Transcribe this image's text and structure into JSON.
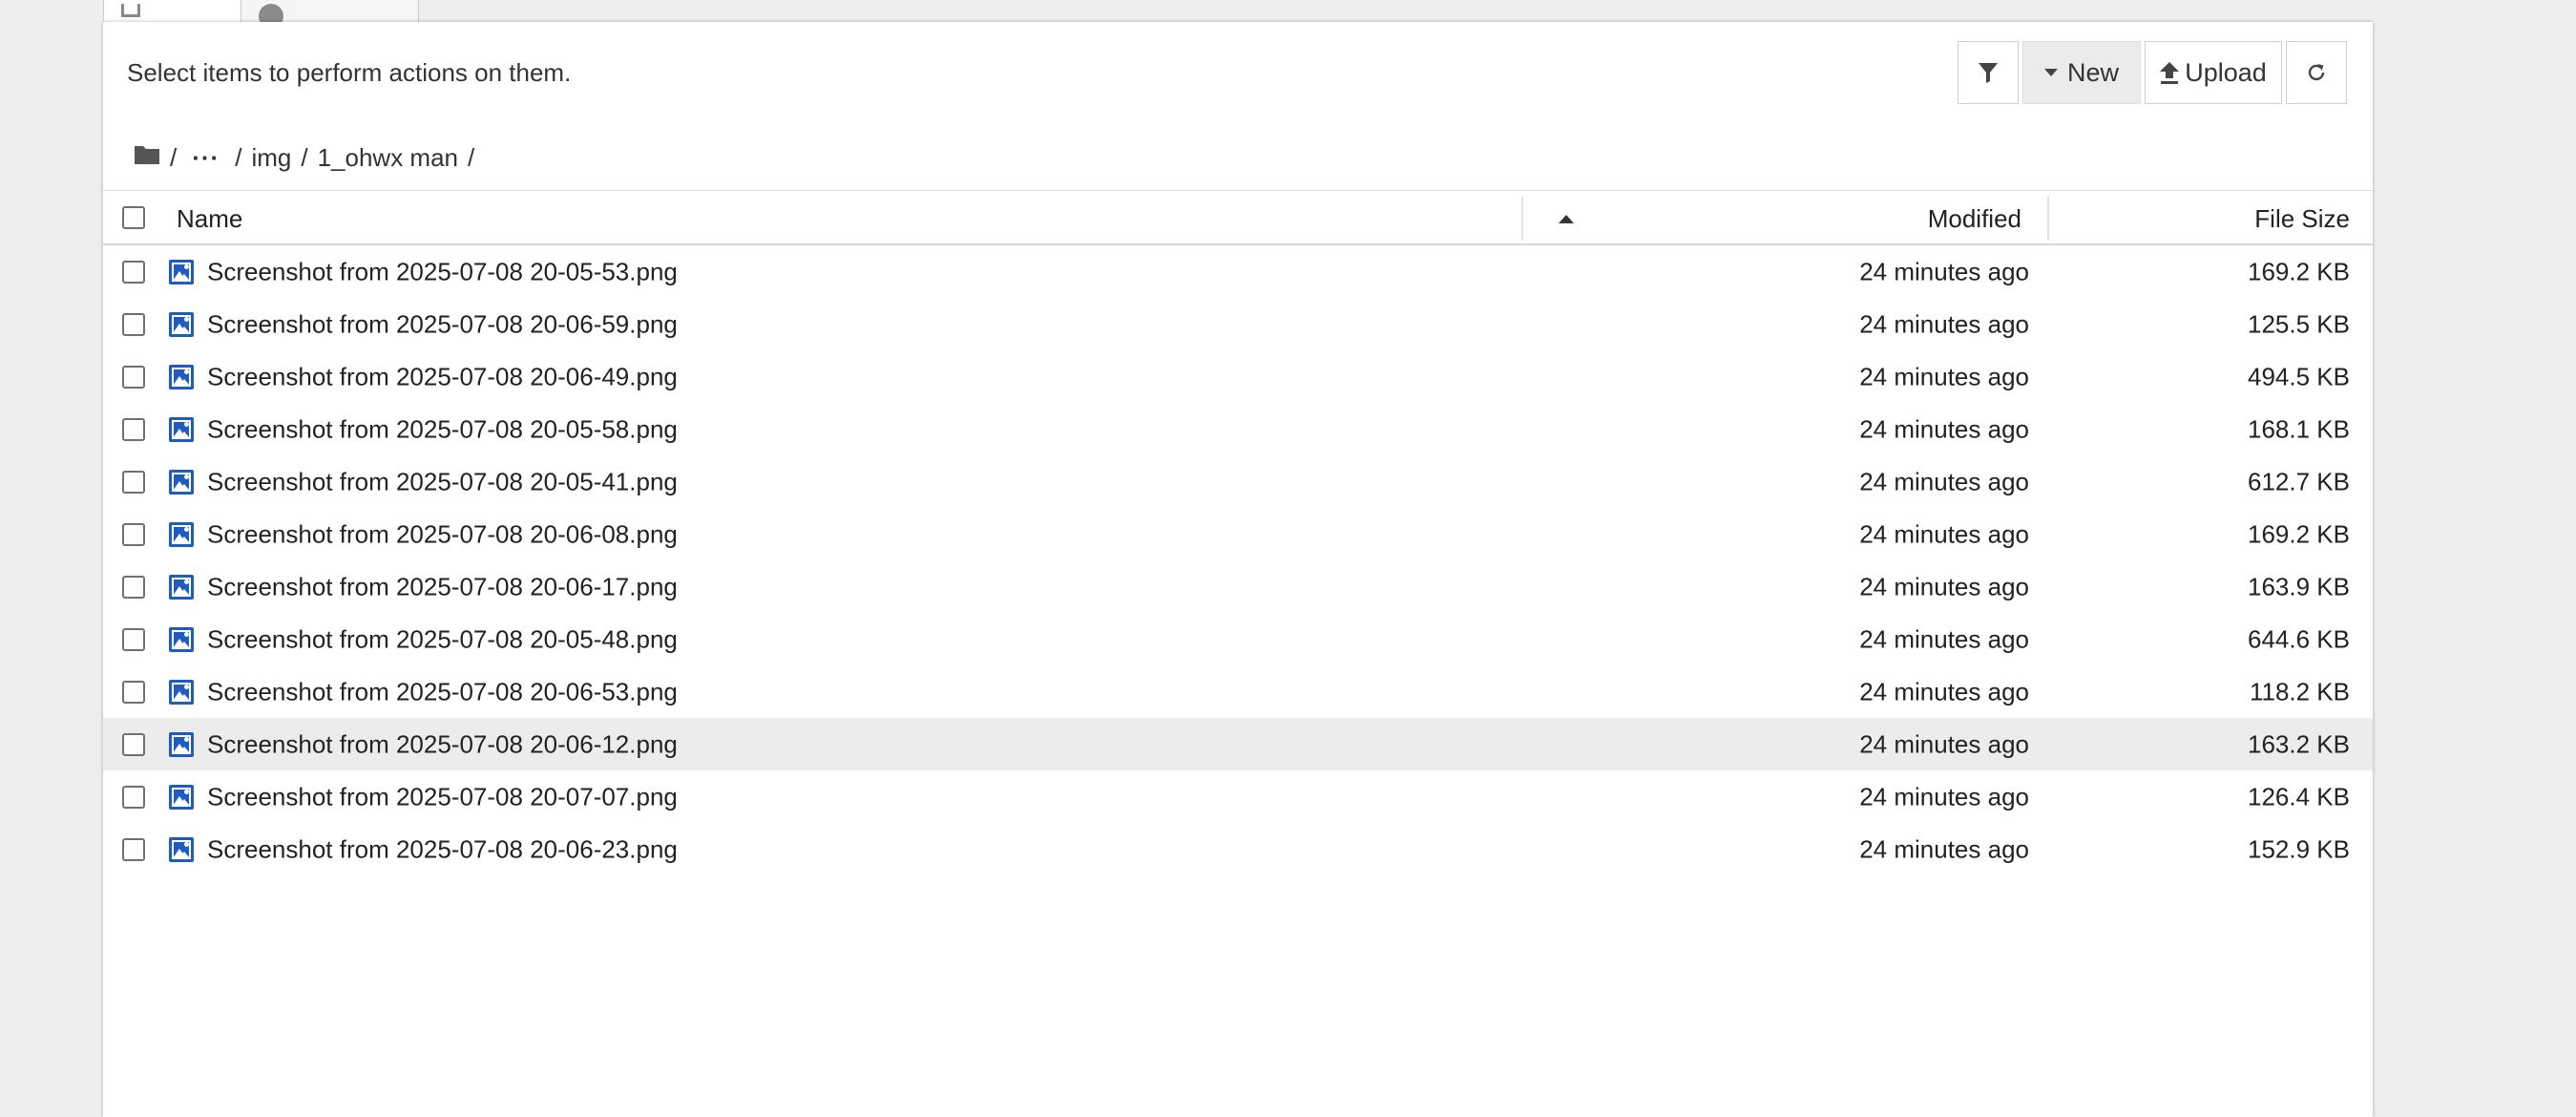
{
  "tabs": [
    {
      "label": ""
    },
    {
      "label": ""
    }
  ],
  "toolbar": {
    "hint": "Select items to perform actions on them.",
    "new_label": "New",
    "upload_label": "Upload"
  },
  "breadcrumb": {
    "ellipsis": "···",
    "items": [
      "img",
      "1_ohwx man"
    ],
    "separator": "/"
  },
  "table": {
    "headers": {
      "name": "Name",
      "modified": "Modified",
      "size": "File Size"
    },
    "rows": [
      {
        "name": "Screenshot from 2025-07-08 20-05-53.png",
        "modified": "24 minutes ago",
        "size": "169.2 KB"
      },
      {
        "name": "Screenshot from 2025-07-08 20-06-59.png",
        "modified": "24 minutes ago",
        "size": "125.5 KB"
      },
      {
        "name": "Screenshot from 2025-07-08 20-06-49.png",
        "modified": "24 minutes ago",
        "size": "494.5 KB"
      },
      {
        "name": "Screenshot from 2025-07-08 20-05-58.png",
        "modified": "24 minutes ago",
        "size": "168.1 KB"
      },
      {
        "name": "Screenshot from 2025-07-08 20-05-41.png",
        "modified": "24 minutes ago",
        "size": "612.7 KB"
      },
      {
        "name": "Screenshot from 2025-07-08 20-06-08.png",
        "modified": "24 minutes ago",
        "size": "169.2 KB"
      },
      {
        "name": "Screenshot from 2025-07-08 20-06-17.png",
        "modified": "24 minutes ago",
        "size": "163.9 KB"
      },
      {
        "name": "Screenshot from 2025-07-08 20-05-48.png",
        "modified": "24 minutes ago",
        "size": "644.6 KB"
      },
      {
        "name": "Screenshot from 2025-07-08 20-06-53.png",
        "modified": "24 minutes ago",
        "size": "118.2 KB"
      },
      {
        "name": "Screenshot from 2025-07-08 20-06-12.png",
        "modified": "24 minutes ago",
        "size": "163.2 KB"
      },
      {
        "name": "Screenshot from 2025-07-08 20-07-07.png",
        "modified": "24 minutes ago",
        "size": "126.4 KB"
      },
      {
        "name": "Screenshot from 2025-07-08 20-06-23.png",
        "modified": "24 minutes ago",
        "size": "152.9 KB"
      }
    ],
    "hovered_row": 9
  },
  "colors": {
    "file_icon": "#1e5cc0",
    "hover_row": "#ececec",
    "new_button_bg": "#ebebeb"
  },
  "icons": {
    "filter": "filter-icon",
    "new": "caret-down-icon",
    "upload": "upload-icon",
    "refresh": "refresh-icon",
    "folder": "folder-icon",
    "file": "image-file-icon",
    "sort": "sort-ascending-icon"
  }
}
